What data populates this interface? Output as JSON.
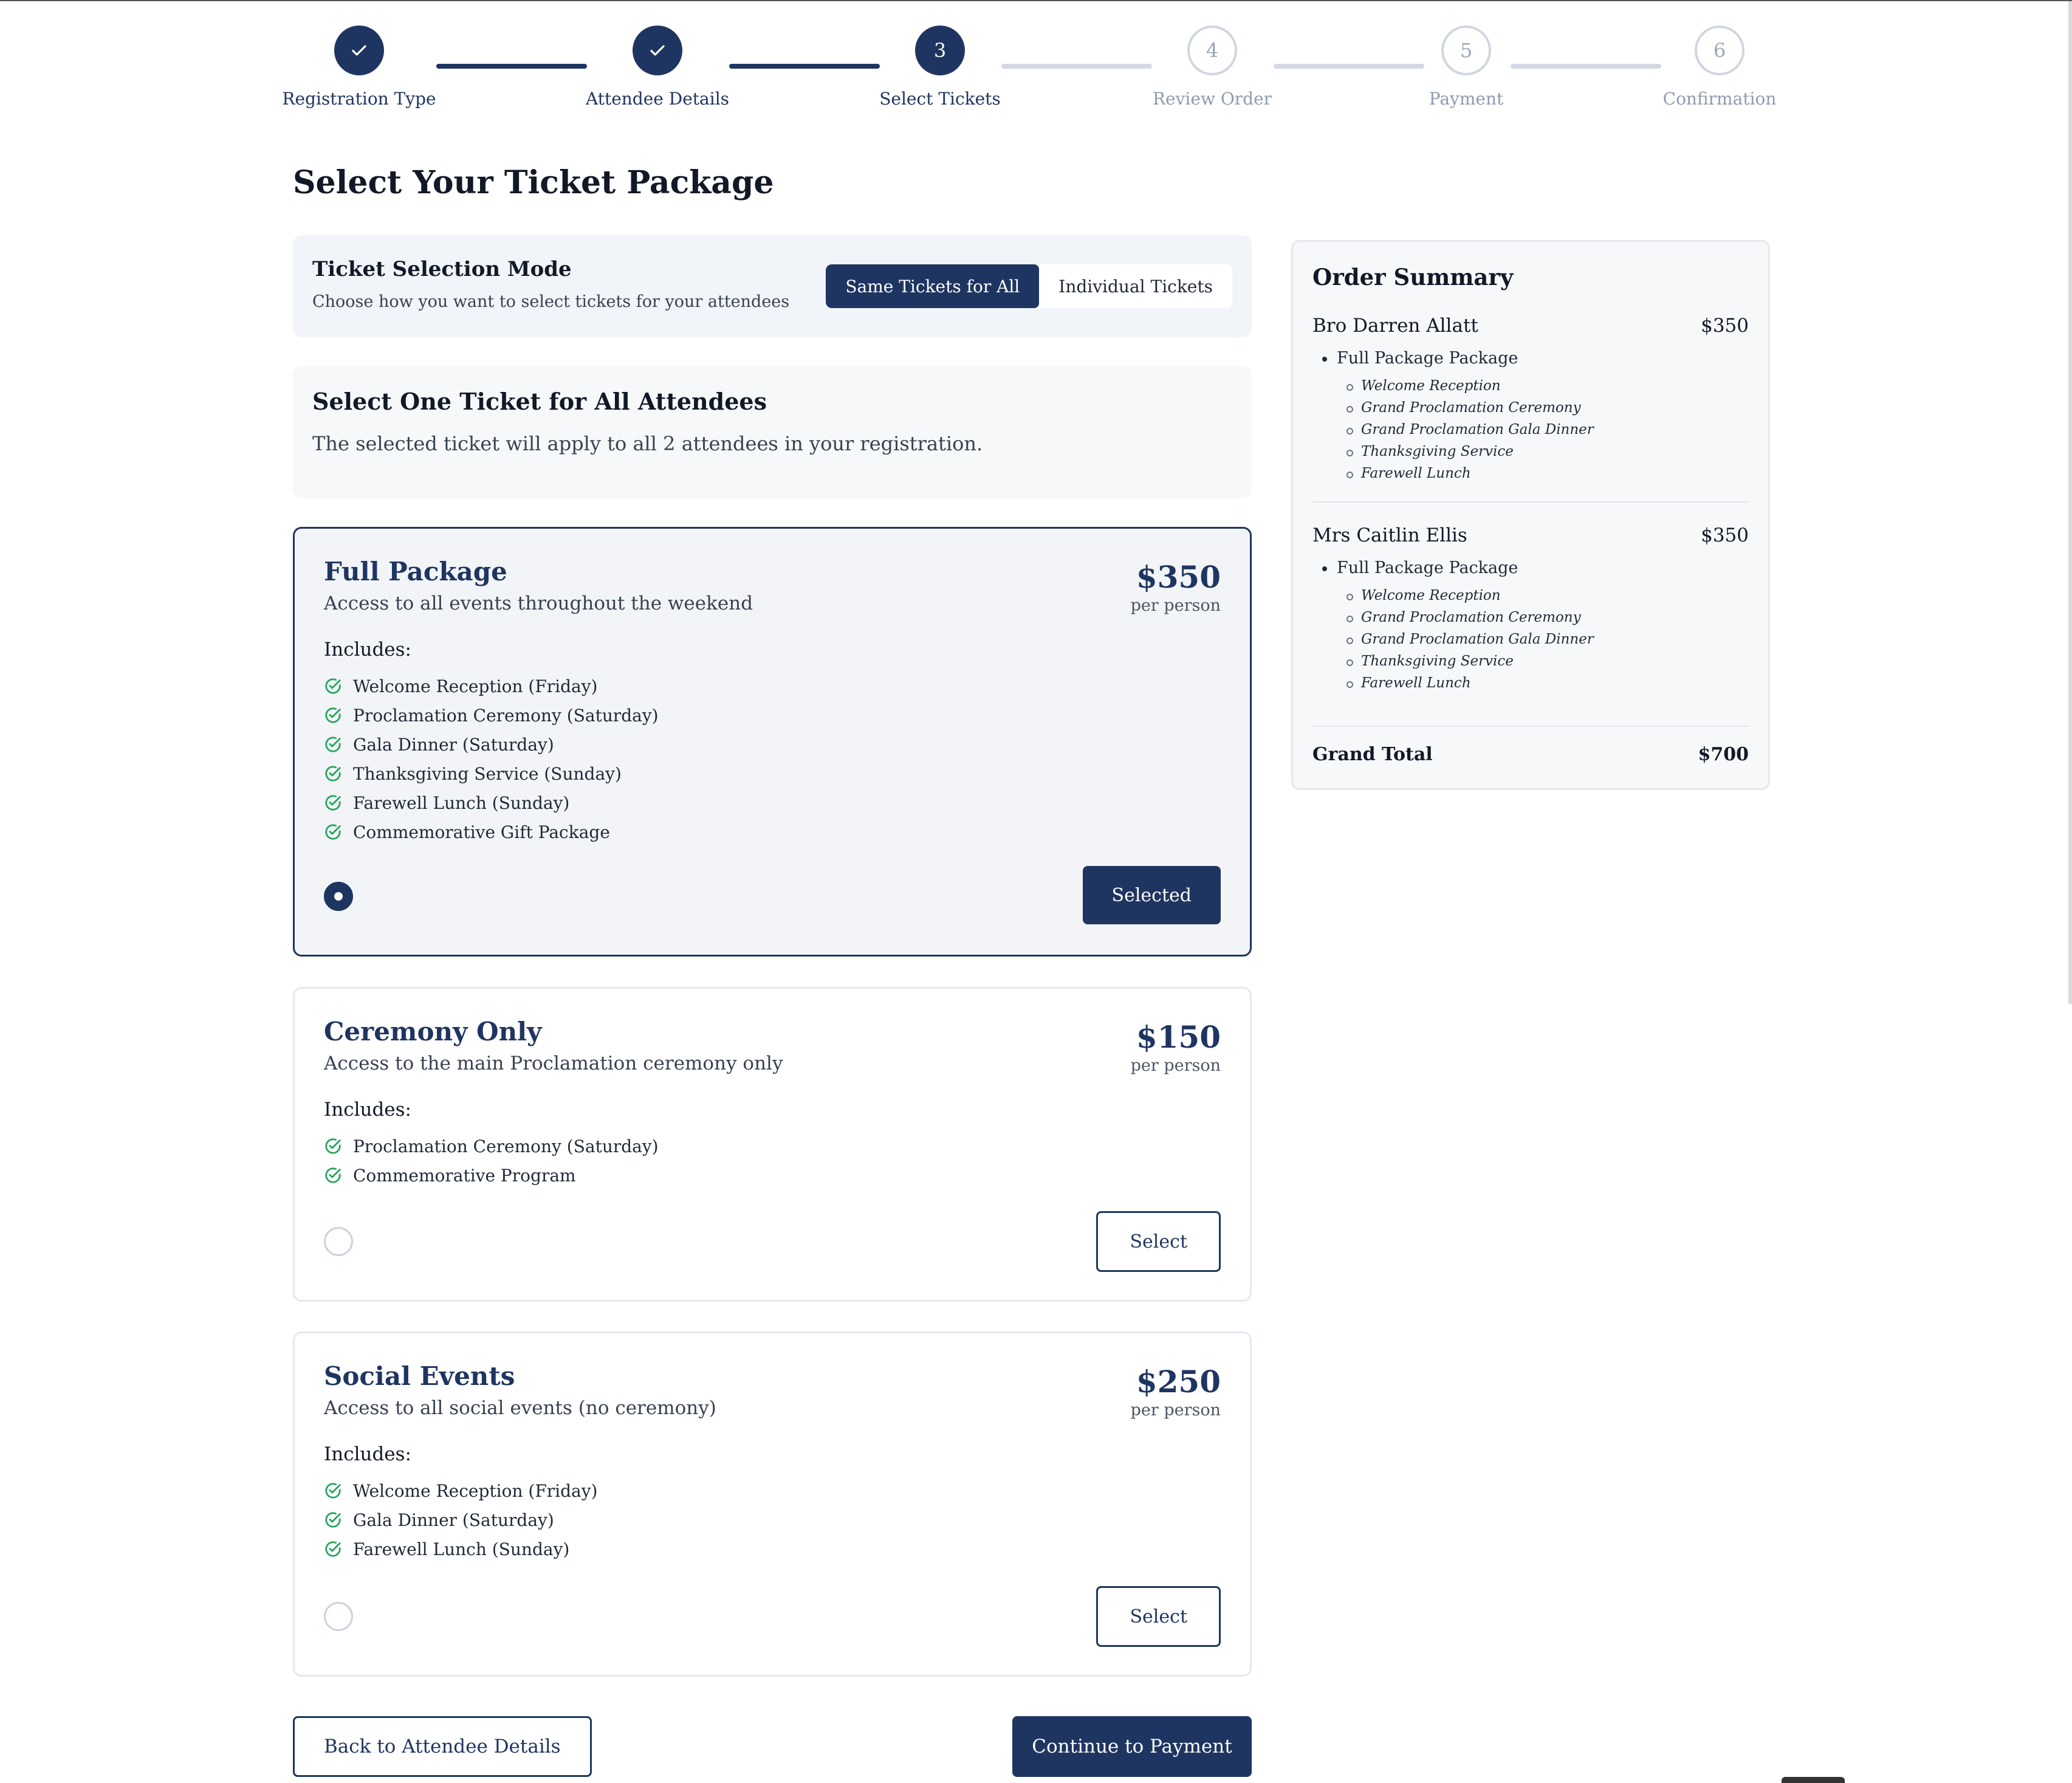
{
  "stepper": {
    "steps": [
      {
        "label": "Registration Type",
        "number": "",
        "status": "done"
      },
      {
        "label": "Attendee Details",
        "number": "",
        "status": "done"
      },
      {
        "label": "Select Tickets",
        "number": "3",
        "status": "current"
      },
      {
        "label": "Review Order",
        "number": "4",
        "status": "todo"
      },
      {
        "label": "Payment",
        "number": "5",
        "status": "todo"
      },
      {
        "label": "Confirmation",
        "number": "6",
        "status": "todo"
      }
    ],
    "check_icon": "check-icon"
  },
  "page": {
    "title": "Select Your Ticket Package"
  },
  "mode": {
    "title": "Ticket Selection Mode",
    "subtitle": "Choose how you want to select tickets for your attendees",
    "options": [
      "Same Tickets for All",
      "Individual Tickets"
    ],
    "selected": "Same Tickets for All"
  },
  "info": {
    "title": "Select One Ticket for All Attendees",
    "text": "The selected ticket will apply to all 2 attendees in your registration."
  },
  "packages": [
    {
      "name": "Full Package",
      "description": "Access to all events throughout the weekend",
      "price": "$350",
      "per": "per person",
      "includes_label": "Includes:",
      "includes": [
        "Welcome Reception (Friday)",
        "Proclamation Ceremony (Saturday)",
        "Gala Dinner (Saturday)",
        "Thanksgiving Service (Sunday)",
        "Farewell Lunch (Sunday)",
        "Commemorative Gift Package"
      ],
      "button": "Selected",
      "selected": true
    },
    {
      "name": "Ceremony Only",
      "description": "Access to the main Proclamation ceremony only",
      "price": "$150",
      "per": "per person",
      "includes_label": "Includes:",
      "includes": [
        "Proclamation Ceremony (Saturday)",
        "Commemorative Program"
      ],
      "button": "Select",
      "selected": false
    },
    {
      "name": "Social Events",
      "description": "Access to all social events (no ceremony)",
      "price": "$250",
      "per": "per person",
      "includes_label": "Includes:",
      "includes": [
        "Welcome Reception (Friday)",
        "Gala Dinner (Saturday)",
        "Farewell Lunch (Sunday)"
      ],
      "button": "Select",
      "selected": false
    }
  ],
  "summary": {
    "title": "Order Summary",
    "attendees": [
      {
        "name": "Bro Darren Allatt",
        "amount": "$350",
        "package": "Full Package Package",
        "events": [
          "Welcome Reception",
          "Grand Proclamation Ceremony",
          "Grand Proclamation Gala Dinner",
          "Thanksgiving Service",
          "Farewell Lunch"
        ]
      },
      {
        "name": "Mrs Caitlin Ellis",
        "amount": "$350",
        "package": "Full Package Package",
        "events": [
          "Welcome Reception",
          "Grand Proclamation Ceremony",
          "Grand Proclamation Gala Dinner",
          "Thanksgiving Service",
          "Farewell Lunch"
        ]
      }
    ],
    "total_label": "Grand Total",
    "total": "$700"
  },
  "nav": {
    "back": "Back to Attendee Details",
    "next": "Continue to Payment"
  },
  "colors": {
    "primary": "#1f3561",
    "check": "#22a55a",
    "muted": "#8e9bb0"
  }
}
